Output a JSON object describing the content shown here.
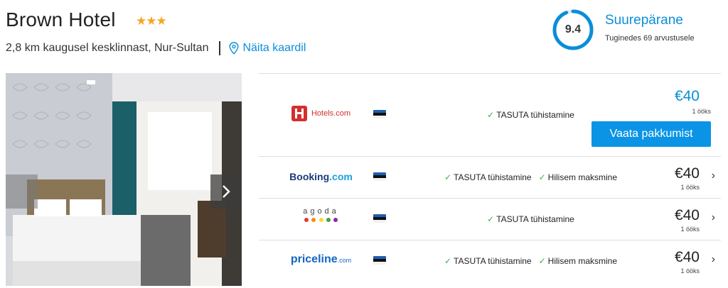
{
  "hotel": {
    "name": "Brown Hotel",
    "stars": "★★★",
    "location": "2,8 km kaugusel kesklinnast, Nur-Sultan",
    "map_link": "Näita kaardil"
  },
  "rating": {
    "score": "9.4",
    "score_fraction": 0.94,
    "label": "Suurepärane",
    "reviews": "Tuginedes 69 arvustusele"
  },
  "colors": {
    "accent": "#0b8ed8",
    "button": "#0b94e5",
    "check": "#3ab54a",
    "stars": "#f5a623"
  },
  "offers": [
    {
      "provider": "Hotels.com",
      "perk1": "TASUTA tühistamine",
      "perk2": "",
      "price": "€40",
      "per_night": "1 ööks",
      "button": "Vaata pakkumist"
    },
    {
      "provider_a": "Booking",
      "provider_b": ".com",
      "perk1": "TASUTA tühistamine",
      "perk2": "Hilisem maksmine",
      "price": "€40",
      "per_night": "1 ööks"
    },
    {
      "provider": "agoda",
      "perk1": "TASUTA tühistamine",
      "perk2": "",
      "price": "€40",
      "per_night": "1 ööks"
    },
    {
      "provider_a": "priceline",
      "provider_b": ".com",
      "perk1": "TASUTA tühistamine",
      "perk2": "Hilisem maksmine",
      "price": "€40",
      "per_night": "1 ööks"
    }
  ],
  "icons": {
    "map": "map-pin-icon",
    "next": "chevron-right-icon",
    "check": "check-icon",
    "flag": "estonia-flag-icon"
  }
}
